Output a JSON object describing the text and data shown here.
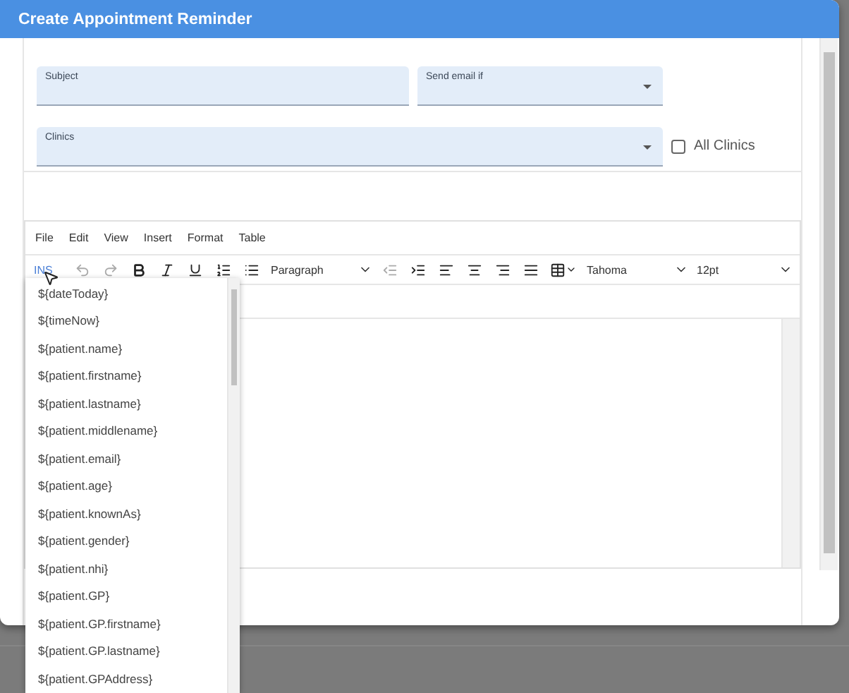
{
  "window": {
    "title": "Create Appointment Reminder"
  },
  "fields": [
    {
      "label": "Subject",
      "kind": "text"
    },
    {
      "label": "Send email if",
      "kind": "select"
    },
    {
      "label": "Clinics",
      "kind": "select"
    }
  ],
  "all_clinics": {
    "label": "All Clinics",
    "checked": false
  },
  "editor": {
    "menu": [
      "File",
      "Edit",
      "View",
      "Insert",
      "Format",
      "Table"
    ],
    "toolbar": {
      "insert_label": "INS",
      "undo_disabled": true,
      "redo_disabled": true,
      "outdent_disabled": true,
      "block_format": "Paragraph",
      "font": "Tahoma",
      "size": "12pt"
    }
  },
  "insert_menu": {
    "items": [
      "${dateToday}",
      "${timeNow}",
      "${patient.name}",
      "${patient.firstname}",
      "${patient.lastname}",
      "${patient.middlename}",
      "${patient.email}",
      "${patient.age}",
      "${patient.knownAs}",
      "${patient.gender}",
      "${patient.nhi}",
      "${patient.GP}",
      "${patient.GP.firstname}",
      "${patient.GP.lastname}",
      "${patient.GPAddress}"
    ]
  }
}
